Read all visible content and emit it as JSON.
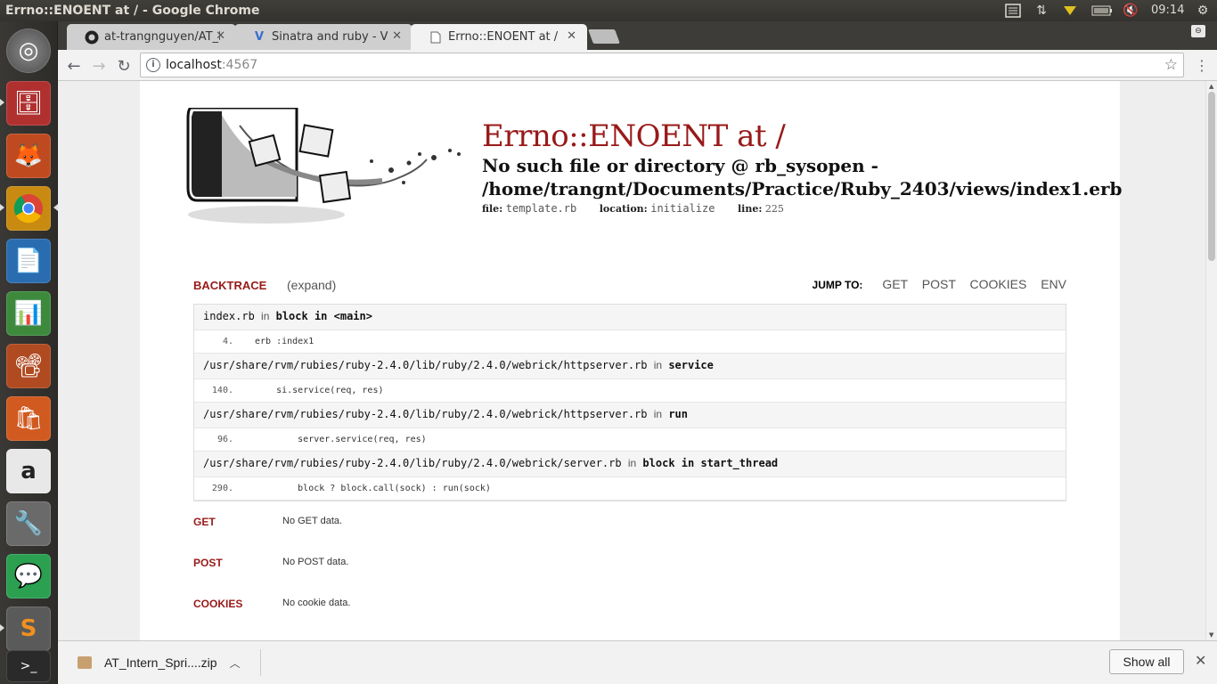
{
  "os": {
    "window_title": "Errno::ENOENT at / - Google Chrome",
    "clock": "09:14"
  },
  "tabs": [
    {
      "label": "at-trangnguyen/AT_I",
      "favicon": "github-icon",
      "active": false
    },
    {
      "label": "Sinatra and ruby - Vib",
      "favicon": "v-icon",
      "active": false
    },
    {
      "label": "Errno::ENOENT at /",
      "favicon": "page-icon",
      "active": true
    }
  ],
  "address": {
    "host": "localhost",
    "port": ":4567"
  },
  "page": {
    "title": "Errno::ENOENT at /",
    "message_line1": "No such file or directory @ rb_sysopen -",
    "message_line2": "/home/trangnt/Documents/Practice/Ruby_2403/views/index1.erb",
    "file_label": "file:",
    "file_value": "template.rb",
    "location_label": "location:",
    "location_value": "initialize",
    "line_label": "line:",
    "line_value": "225",
    "backtrace_title": "BACKTRACE",
    "expand": "(expand)",
    "jump_to": "JUMP TO:",
    "jump_links": [
      "GET",
      "POST",
      "COOKIES",
      "ENV"
    ],
    "frames": [
      {
        "file": "index.rb",
        "in": "in",
        "method": "block in <main>",
        "line": "4.",
        "code": "erb :index1"
      },
      {
        "file": "/usr/share/rvm/rubies/ruby-2.4.0/lib/ruby/2.4.0/webrick/httpserver.rb",
        "in": "in",
        "method": "service",
        "line": "140.",
        "code": "    si.service(req, res)"
      },
      {
        "file": "/usr/share/rvm/rubies/ruby-2.4.0/lib/ruby/2.4.0/webrick/httpserver.rb",
        "in": "in",
        "method": "run",
        "line": "96.",
        "code": "        server.service(req, res)"
      },
      {
        "file": "/usr/share/rvm/rubies/ruby-2.4.0/lib/ruby/2.4.0/webrick/server.rb",
        "in": "in",
        "method": "block in start_thread",
        "line": "290.",
        "code": "        block ? block.call(sock) : run(sock)"
      }
    ],
    "sections": [
      {
        "title": "GET",
        "value": "No GET data."
      },
      {
        "title": "POST",
        "value": "No POST data."
      },
      {
        "title": "COOKIES",
        "value": "No cookie data."
      }
    ]
  },
  "download": {
    "filename": "AT_Intern_Spri....zip",
    "show_all": "Show all"
  },
  "colors": {
    "error_red": "#981919",
    "launcher_bg": "#2d2c29"
  }
}
